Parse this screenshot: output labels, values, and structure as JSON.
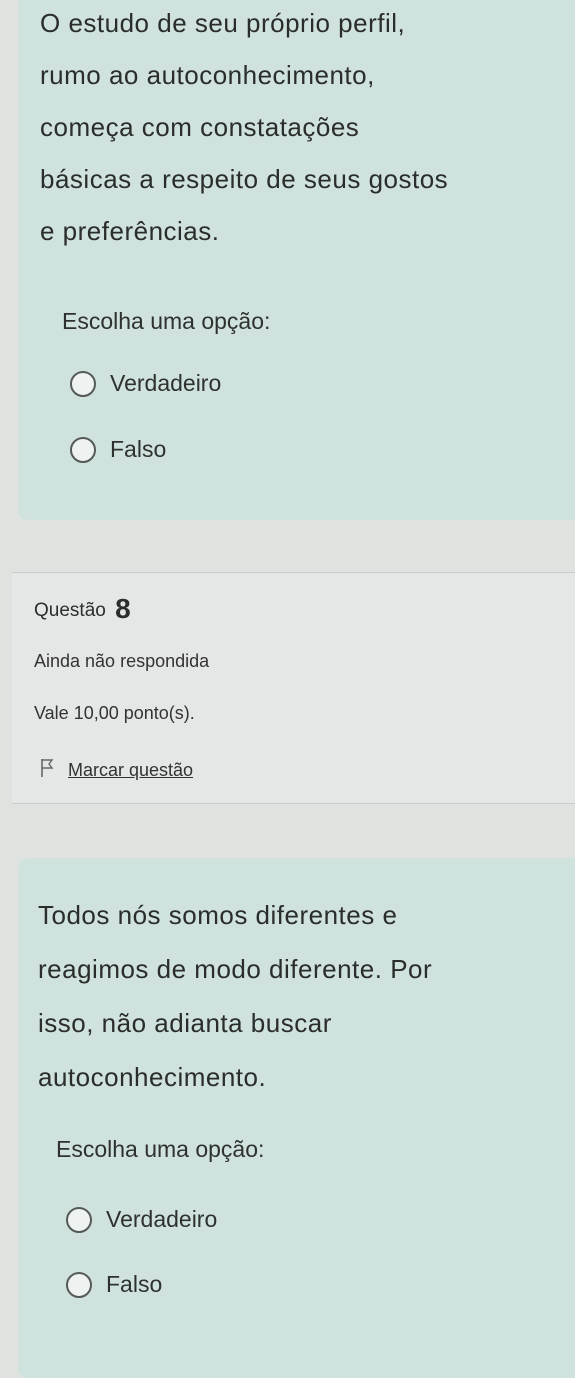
{
  "question_prev": {
    "text_lines": [
      "O estudo de seu próprio perfil,",
      "rumo ao autoconhecimento,",
      "começa com constatações",
      "básicas a respeito de seus gostos",
      "e preferências."
    ],
    "prompt": "Escolha uma opção:",
    "options": [
      "Verdadeiro",
      "Falso"
    ]
  },
  "question_info": {
    "title_label": "Questão",
    "number": "8",
    "status": "Ainda não respondida",
    "points": "Vale 10,00 ponto(s).",
    "flag_label": "Marcar questão",
    "flag_icon": "flag-icon"
  },
  "question_8": {
    "text_lines": [
      "Todos nós somos diferentes e",
      "reagimos de modo diferente. Por",
      "isso, não adianta buscar",
      "autoconhecimento."
    ],
    "prompt": "Escolha uma opção:",
    "options": [
      "Verdadeiro",
      "Falso"
    ]
  }
}
